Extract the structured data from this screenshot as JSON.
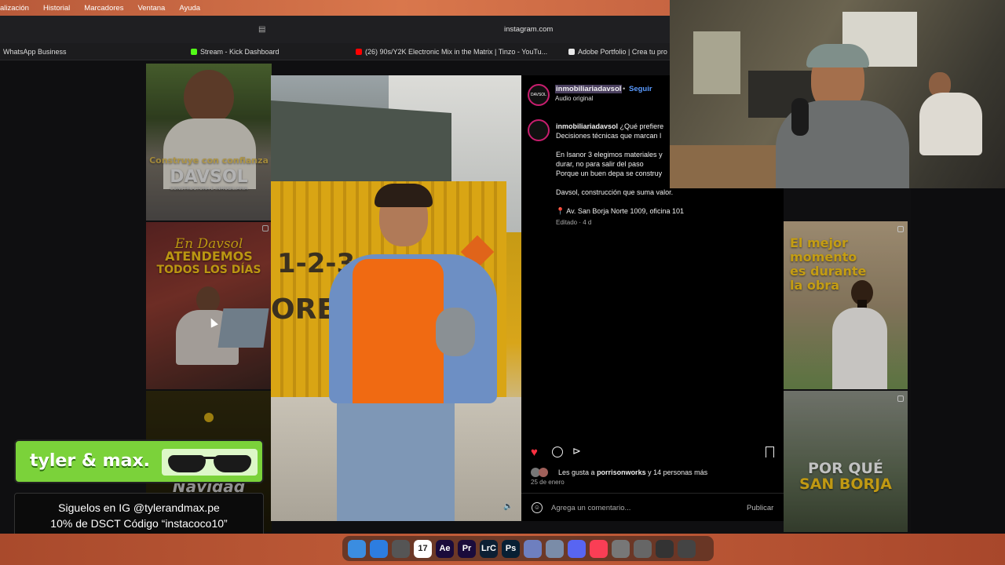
{
  "menubar": {
    "items": [
      "alización",
      "Historial",
      "Marcadores",
      "Ventana",
      "Ayuda"
    ]
  },
  "browser": {
    "url": "instagram.com"
  },
  "bookmarks": [
    {
      "label": "WhatsApp Business",
      "color": ""
    },
    {
      "label": "Stream - Kick Dashboard",
      "color": "#53fc18"
    },
    {
      "label": "(26) 90s/Y2K Electronic Mix in the Matrix | Tinzo - YouTu...",
      "color": "#ff0000"
    },
    {
      "label": "Adobe Portfolio | Crea tu pro",
      "color": "#e8e8e8"
    }
  ],
  "thumbs": {
    "t1": {
      "line1": "Construye con confianza",
      "line2": "DAVSOL",
      "line3": "CONSTRUCTORA E INMOBILIARIA"
    },
    "t2": {
      "line1": "En Davsol",
      "line2": "ATENDEMOS",
      "line3": "TODOS LOS DÍAS"
    },
    "t3": {
      "line1": "Navidad"
    },
    "t4": {
      "line1": "El mejor",
      "line2": "momento",
      "line3": "es durante",
      "line4": "la obra"
    },
    "t5": {
      "line1": "POR QUÉ",
      "line2": "SAN BORJA"
    }
  },
  "post": {
    "username": "inmobiliariadavsol",
    "follow": "Seguir",
    "audio": "Audio original",
    "avatar_text": "DAVSOL",
    "caption_user": "inmobiliariadavsol",
    "caption_l1": "¿Qué prefiere",
    "caption_l2": "Decisiones técnicas que marcan l",
    "caption_l3": "En Isanor 3 elegimos materiales y",
    "caption_l4": "durar, no para salir del paso",
    "caption_l5": "Porque un buen depa se construy",
    "caption_l6": "Davsol, construcción que suma valor.",
    "location": "Av. San Borja Norte 1009, oficina 101",
    "edited": "Editado · 4 d",
    "likes_prefix": "Les gusta a",
    "likes_user": "porrisonworks",
    "likes_suffix": "y 14 personas más",
    "date": "25 de enero",
    "comment_placeholder": "Agrega un comentario...",
    "publish": "Publicar"
  },
  "video_sign": {
    "text1": "1-2-3",
    "text2": "ORE"
  },
  "overlay": {
    "brand": "tyler & max.",
    "promo_l1": "Siguelos en IG @tylerandmax.pe",
    "promo_l2": "10% de DSCT Código “instacoco10”"
  },
  "dock": [
    {
      "name": "finder",
      "label": "",
      "color": "#3b8de0"
    },
    {
      "name": "safari",
      "label": "",
      "color": "#2d7de0"
    },
    {
      "name": "notes-app",
      "label": "",
      "color": "#555"
    },
    {
      "name": "calendar",
      "label": "17",
      "color": "#ffffff"
    },
    {
      "name": "after-effects",
      "label": "Ae",
      "color": "#1a0b3b"
    },
    {
      "name": "premiere",
      "label": "Pr",
      "color": "#1a0b3b"
    },
    {
      "name": "lightroom-classic",
      "label": "LrC",
      "color": "#0c1f33"
    },
    {
      "name": "photoshop",
      "label": "Ps",
      "color": "#071f33"
    },
    {
      "name": "app-blue",
      "label": "",
      "color": "#6e7fbf"
    },
    {
      "name": "keynote",
      "label": "",
      "color": "#7a8ca8"
    },
    {
      "name": "discord",
      "label": "",
      "color": "#5865f2"
    },
    {
      "name": "music",
      "label": "",
      "color": "#fa3e55"
    },
    {
      "name": "app-gray",
      "label": "",
      "color": "#777"
    },
    {
      "name": "app-settings",
      "label": "",
      "color": "#666"
    },
    {
      "name": "app-dark",
      "label": "",
      "color": "#333"
    },
    {
      "name": "trash",
      "label": "",
      "color": "#444"
    }
  ]
}
